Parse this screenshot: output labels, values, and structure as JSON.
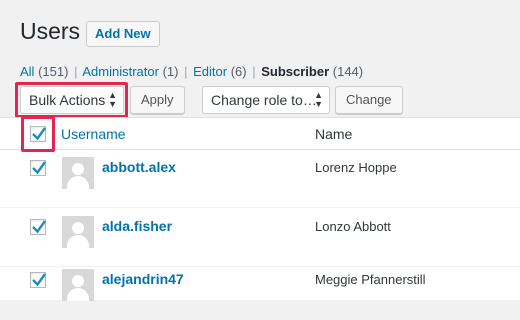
{
  "header": {
    "title": "Users",
    "add_new_label": "Add New"
  },
  "filters": {
    "all_label": "All",
    "all_count": "(151)",
    "administrator_label": "Administrator",
    "administrator_count": "(1)",
    "editor_label": "Editor",
    "editor_count": "(6)",
    "subscriber_label": "Subscriber",
    "subscriber_count": "(144)",
    "separator": "|"
  },
  "bulk_actions": {
    "select_value": "Bulk Actions",
    "apply_label": "Apply",
    "role_select_value": "Change role to…",
    "change_label": "Change"
  },
  "table": {
    "columns": {
      "username": "Username",
      "name": "Name"
    },
    "select_all_checked": true,
    "rows": [
      {
        "username": "abbott.alex",
        "name": "Lorenz Hoppe",
        "checked": true
      },
      {
        "username": "alda.fisher",
        "name": "Lonzo Abbott",
        "checked": true
      },
      {
        "username": "alejandrin47",
        "name": "Meggie Pfannerstill",
        "checked": true
      }
    ]
  },
  "colors": {
    "link": "#0073aa",
    "highlight": "#e2264d",
    "background": "#f1f1f1"
  },
  "icons": {
    "checkbox": "checkmark-icon",
    "avatar": "default-avatar-icon",
    "select": "updown-arrows-icon"
  }
}
